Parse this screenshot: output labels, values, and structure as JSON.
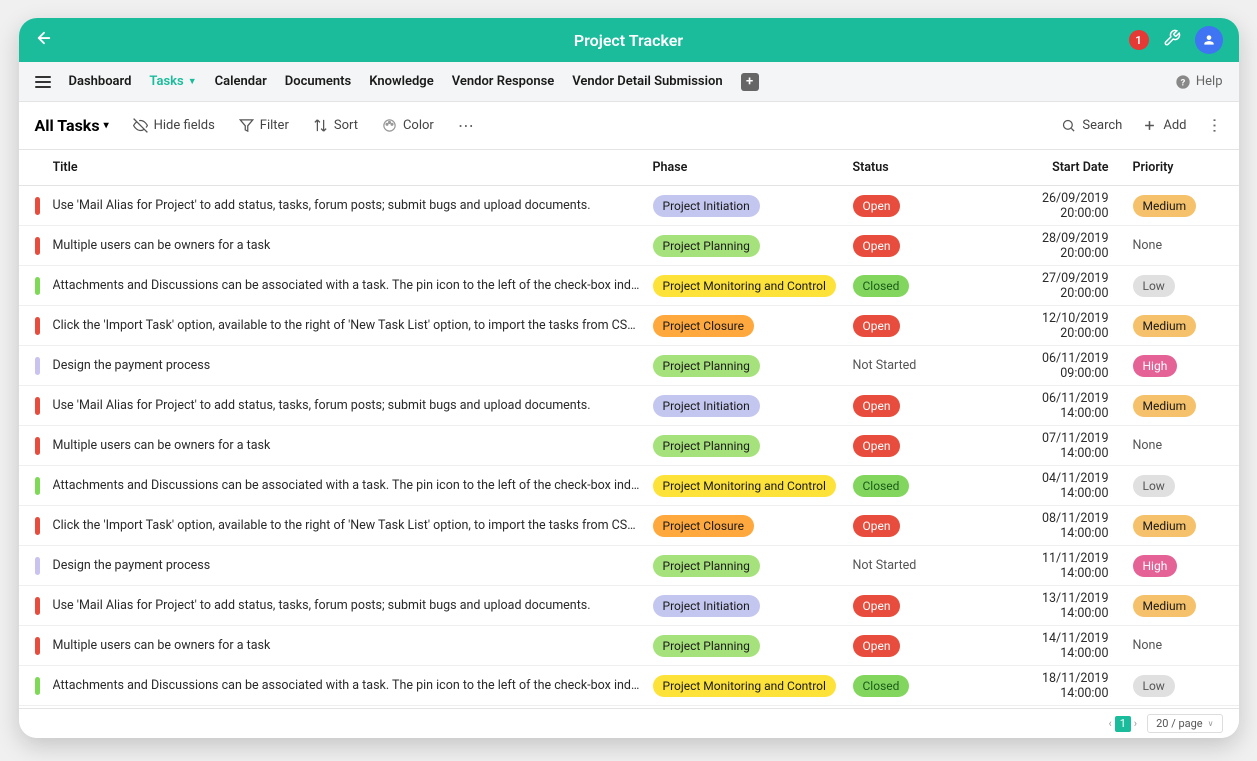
{
  "title_bar": {
    "title": "Project Tracker",
    "notification_count": "1"
  },
  "menu": {
    "items": [
      {
        "label": "Dashboard"
      },
      {
        "label": "Tasks",
        "active": true,
        "dropdown": true
      },
      {
        "label": "Calendar"
      },
      {
        "label": "Documents"
      },
      {
        "label": "Knowledge"
      },
      {
        "label": "Vendor Response"
      },
      {
        "label": "Vendor Detail Submission"
      }
    ],
    "help_label": "Help"
  },
  "toolbar": {
    "view_title": "All Tasks",
    "hide_fields_label": "Hide fields",
    "filter_label": "Filter",
    "sort_label": "Sort",
    "color_label": "Color",
    "search_label": "Search",
    "add_label": "Add"
  },
  "columns": {
    "title": "Title",
    "phase": "Phase",
    "status": "Status",
    "start_date": "Start Date",
    "priority": "Priority"
  },
  "rows": [
    {
      "marker": "#e74c3c",
      "title": "Use 'Mail Alias for Project' to add status, tasks, forum posts; submit bugs and upload documents.",
      "phase": "Project Initiation",
      "phase_class": "phase-initiation",
      "status": "Open",
      "status_class": "status-open",
      "start_date": "26/09/2019 20:00:00",
      "priority": "Medium",
      "priority_class": "prio-medium"
    },
    {
      "marker": "#e74c3c",
      "title": "Multiple users can be owners for a task",
      "phase": "Project Planning",
      "phase_class": "phase-planning",
      "status": "Open",
      "status_class": "status-open",
      "start_date": "28/09/2019 20:00:00",
      "priority": "None",
      "priority_class": "prio-none"
    },
    {
      "marker": "#7ed957",
      "title": "Attachments and Discussions can be associated with a task. The pin icon to the left of the check-box indicates the file…",
      "phase": "Project Monitoring and Control",
      "phase_class": "phase-monitoring",
      "status": "Closed",
      "status_class": "status-closed",
      "start_date": "27/09/2019 20:00:00",
      "priority": "Low",
      "priority_class": "prio-low"
    },
    {
      "marker": "#e74c3c",
      "title": "Click the 'Import Task' option, available to the right of 'New Task List' option, to import the tasks from CSV, JSON and XLS…",
      "phase": "Project Closure",
      "phase_class": "phase-closure",
      "status": "Open",
      "status_class": "status-open",
      "start_date": "12/10/2019 20:00:00",
      "priority": "Medium",
      "priority_class": "prio-medium"
    },
    {
      "marker": "#c9c3ef",
      "title": "Design the payment process",
      "phase": "Project Planning",
      "phase_class": "phase-planning",
      "status": "Not Started",
      "status_class": "status-text",
      "start_date": "06/11/2019 09:00:00",
      "priority": "High",
      "priority_class": "prio-high"
    },
    {
      "marker": "#e74c3c",
      "title": "Use 'Mail Alias for Project' to add status, tasks, forum posts; submit bugs and upload documents.",
      "phase": "Project Initiation",
      "phase_class": "phase-initiation",
      "status": "Open",
      "status_class": "status-open",
      "start_date": "06/11/2019 14:00:00",
      "priority": "Medium",
      "priority_class": "prio-medium"
    },
    {
      "marker": "#e74c3c",
      "title": "Multiple users can be owners for a task",
      "phase": "Project Planning",
      "phase_class": "phase-planning",
      "status": "Open",
      "status_class": "status-open",
      "start_date": "07/11/2019 14:00:00",
      "priority": "None",
      "priority_class": "prio-none"
    },
    {
      "marker": "#7ed957",
      "title": "Attachments and Discussions can be associated with a task. The pin icon to the left of the check-box indicates the file…",
      "phase": "Project Monitoring and Control",
      "phase_class": "phase-monitoring",
      "status": "Closed",
      "status_class": "status-closed",
      "start_date": "04/11/2019 14:00:00",
      "priority": "Low",
      "priority_class": "prio-low"
    },
    {
      "marker": "#e74c3c",
      "title": "Click the 'Import Task' option, available to the right of 'New Task List' option, to import the tasks from CSV, JSON and XLS…",
      "phase": "Project Closure",
      "phase_class": "phase-closure",
      "status": "Open",
      "status_class": "status-open",
      "start_date": "08/11/2019 14:00:00",
      "priority": "Medium",
      "priority_class": "prio-medium"
    },
    {
      "marker": "#c9c3ef",
      "title": "Design the payment process",
      "phase": "Project Planning",
      "phase_class": "phase-planning",
      "status": "Not Started",
      "status_class": "status-text",
      "start_date": "11/11/2019 14:00:00",
      "priority": "High",
      "priority_class": "prio-high"
    },
    {
      "marker": "#e74c3c",
      "title": "Use 'Mail Alias for Project' to add status, tasks, forum posts; submit bugs and upload documents.",
      "phase": "Project Initiation",
      "phase_class": "phase-initiation",
      "status": "Open",
      "status_class": "status-open",
      "start_date": "13/11/2019 14:00:00",
      "priority": "Medium",
      "priority_class": "prio-medium"
    },
    {
      "marker": "#e74c3c",
      "title": "Multiple users can be owners for a task",
      "phase": "Project Planning",
      "phase_class": "phase-planning",
      "status": "Open",
      "status_class": "status-open",
      "start_date": "14/11/2019 14:00:00",
      "priority": "None",
      "priority_class": "prio-none"
    },
    {
      "marker": "#7ed957",
      "title": "Attachments and Discussions can be associated with a task. The pin icon to the left of the check-box indicates the file…",
      "phase": "Project Monitoring and Control",
      "phase_class": "phase-monitoring",
      "status": "Closed",
      "status_class": "status-closed",
      "start_date": "18/11/2019 14:00:00",
      "priority": "Low",
      "priority_class": "prio-low"
    }
  ],
  "footer": {
    "page": "1",
    "page_size": "20 / page"
  }
}
